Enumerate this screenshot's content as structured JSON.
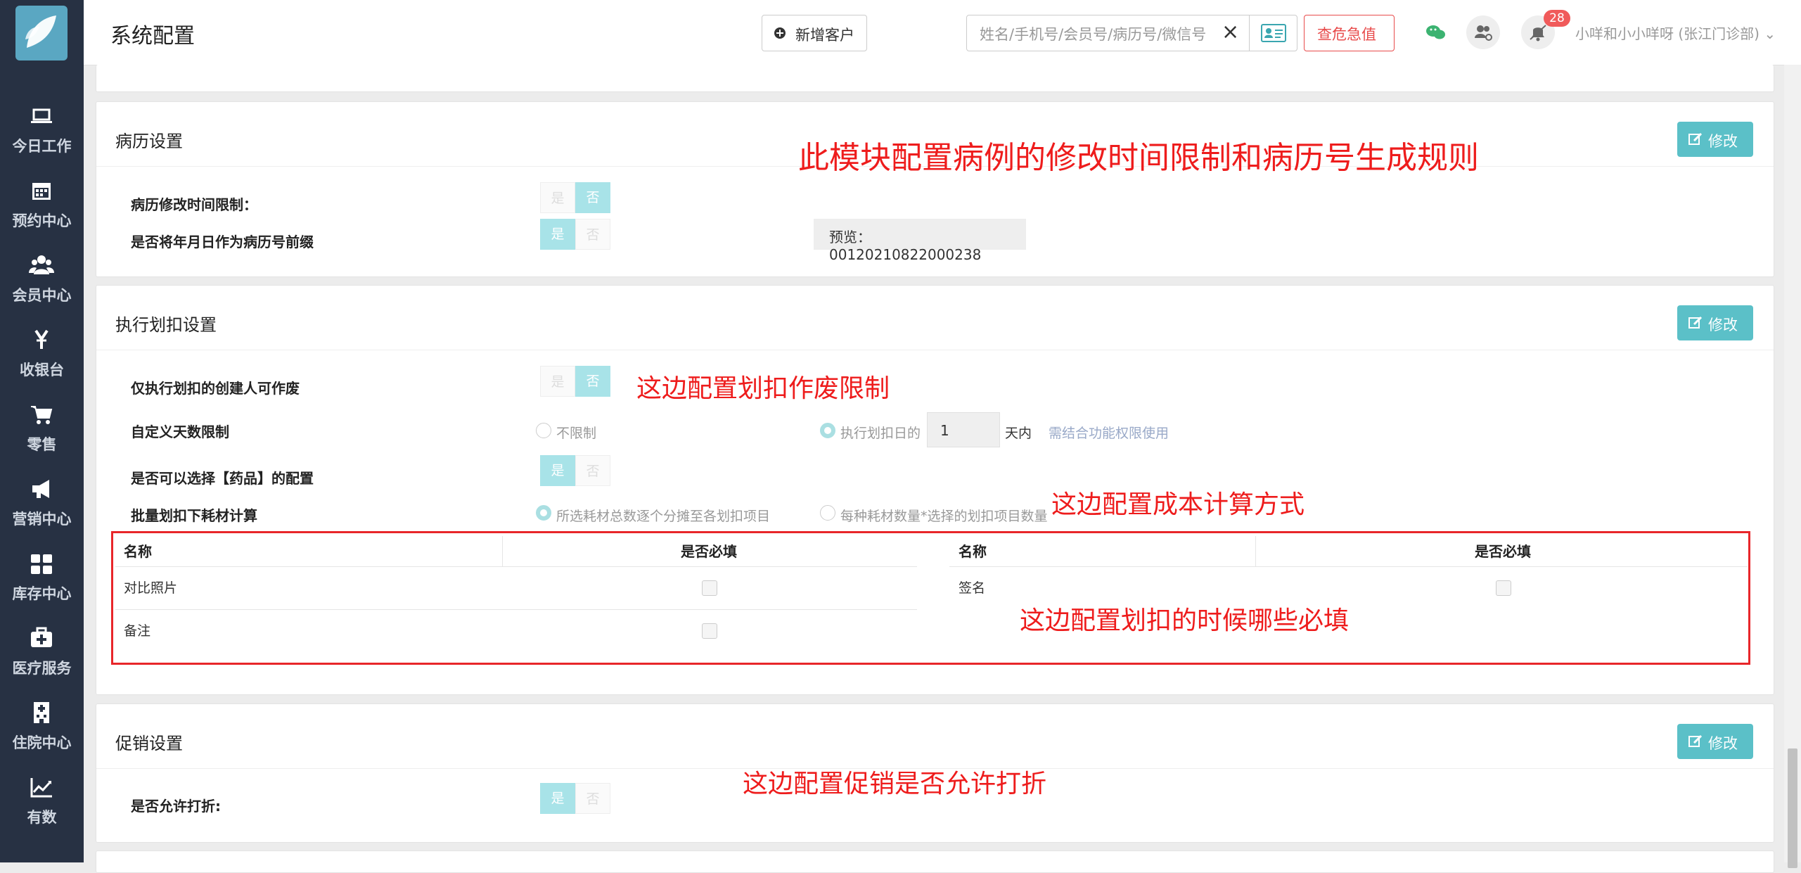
{
  "sidebar": {
    "items": [
      {
        "label": "今日工作",
        "icon": "laptop-icon"
      },
      {
        "label": "预约中心",
        "icon": "calendar-icon"
      },
      {
        "label": "会员中心",
        "icon": "users-icon"
      },
      {
        "label": "收银台",
        "icon": "yen-icon"
      },
      {
        "label": "零售",
        "icon": "cart-icon"
      },
      {
        "label": "营销中心",
        "icon": "megaphone-icon"
      },
      {
        "label": "库存中心",
        "icon": "grid-icon"
      },
      {
        "label": "医疗服务",
        "icon": "medkit-icon"
      },
      {
        "label": "住院中心",
        "icon": "hospital-icon"
      },
      {
        "label": "有数",
        "icon": "chart-icon"
      }
    ]
  },
  "header": {
    "title": "系统配置",
    "add_customer": "新增客户",
    "search_placeholder": "姓名/手机号/会员号/病历号/微信号",
    "danger_label": "危急值",
    "notification_count": "28",
    "user": "小咩和小小咩呀 (张江门诊部)"
  },
  "common": {
    "edit": "修改",
    "yes": "是",
    "no": "否"
  },
  "medical_record": {
    "title": "病历设置",
    "annotation": "此模块配置病例的修改时间限制和病历号生成规则",
    "time_limit_label": "病历修改时间限制：",
    "prefix_label": "是否将年月日作为病历号前缀",
    "preview": "预览：  00120210822000238"
  },
  "deduction": {
    "title": "执行划扣设置",
    "void_label": "仅执行划扣的创建人可作废",
    "void_annotation": "这边配置划扣作废限制",
    "days_label": "自定义天数限制",
    "unlimited": "不限制",
    "from_day": "执行划扣日的",
    "days_value": "1",
    "days_unit": "天内",
    "days_hint": "需结合功能权限使用",
    "drug_label": "是否可以选择【药品】的配置",
    "batch_label": "批量划扣下耗材计算",
    "batch_opt1": "所选耗材总数逐个分摊至各划扣项目",
    "batch_opt2": "每种耗材数量*选择的划扣项目数量",
    "cost_annotation": "这边配置成本计算方式",
    "table": {
      "col_name": "名称",
      "col_required": "是否必填",
      "left_rows": [
        "对比照片",
        "备注"
      ],
      "right_rows": [
        "签名"
      ]
    },
    "required_annotation": "这边配置划扣的时候哪些必填"
  },
  "promotion": {
    "title": "促销设置",
    "annotation": "这边配置促销是否允许打折",
    "discount_label": "是否允许打折:"
  },
  "colors": {
    "sidebar": "#273143",
    "accent": "#5bc0c8",
    "danger": "#e84b4b",
    "annotation": "#ee1c1c"
  }
}
